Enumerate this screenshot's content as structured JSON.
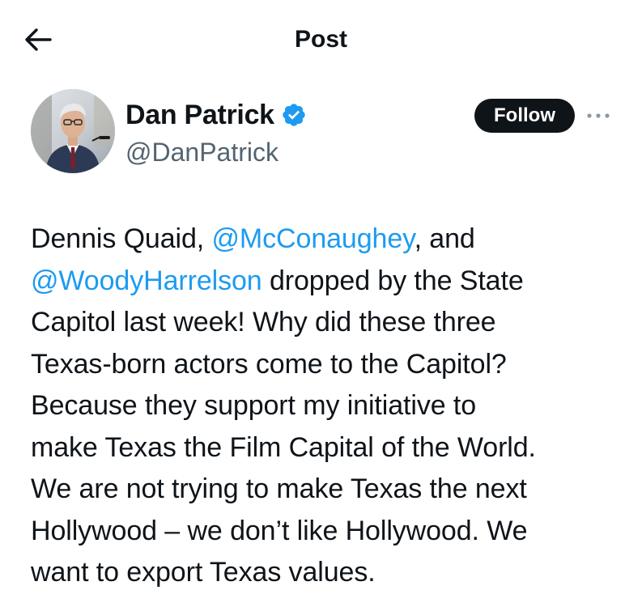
{
  "header": {
    "title": "Post",
    "back_icon": "arrow-left-icon"
  },
  "author": {
    "display_name": "Dan Patrick",
    "handle": "@DanPatrick",
    "verified": true,
    "verified_icon": "verified-badge-icon",
    "verified_color": "#1d9bf0"
  },
  "actions": {
    "follow_label": "Follow",
    "more_icon": "more-options-icon"
  },
  "tweet": {
    "line1_text_a": "Dennis Quaid, ",
    "line1_mention": "@McConaughey",
    "line1_text_b": ", and",
    "line2_mention": "@WoodyHarrelson",
    "line2_text": " dropped by the State",
    "line3": "Capitol last week! Why did these three",
    "line4": "Texas-born actors come to the Capitol?",
    "line5": "Because they support my initiative to",
    "line6": "make Texas the Film Capital of the World.",
    "line7": "We are not trying to make Texas the next",
    "line8": "Hollywood – we don’t like Hollywood. We",
    "line9": "want to export Texas values."
  },
  "colors": {
    "text": "#0f1419",
    "secondary": "#536471",
    "link": "#1d9bf0",
    "button_bg": "#0f1419"
  }
}
